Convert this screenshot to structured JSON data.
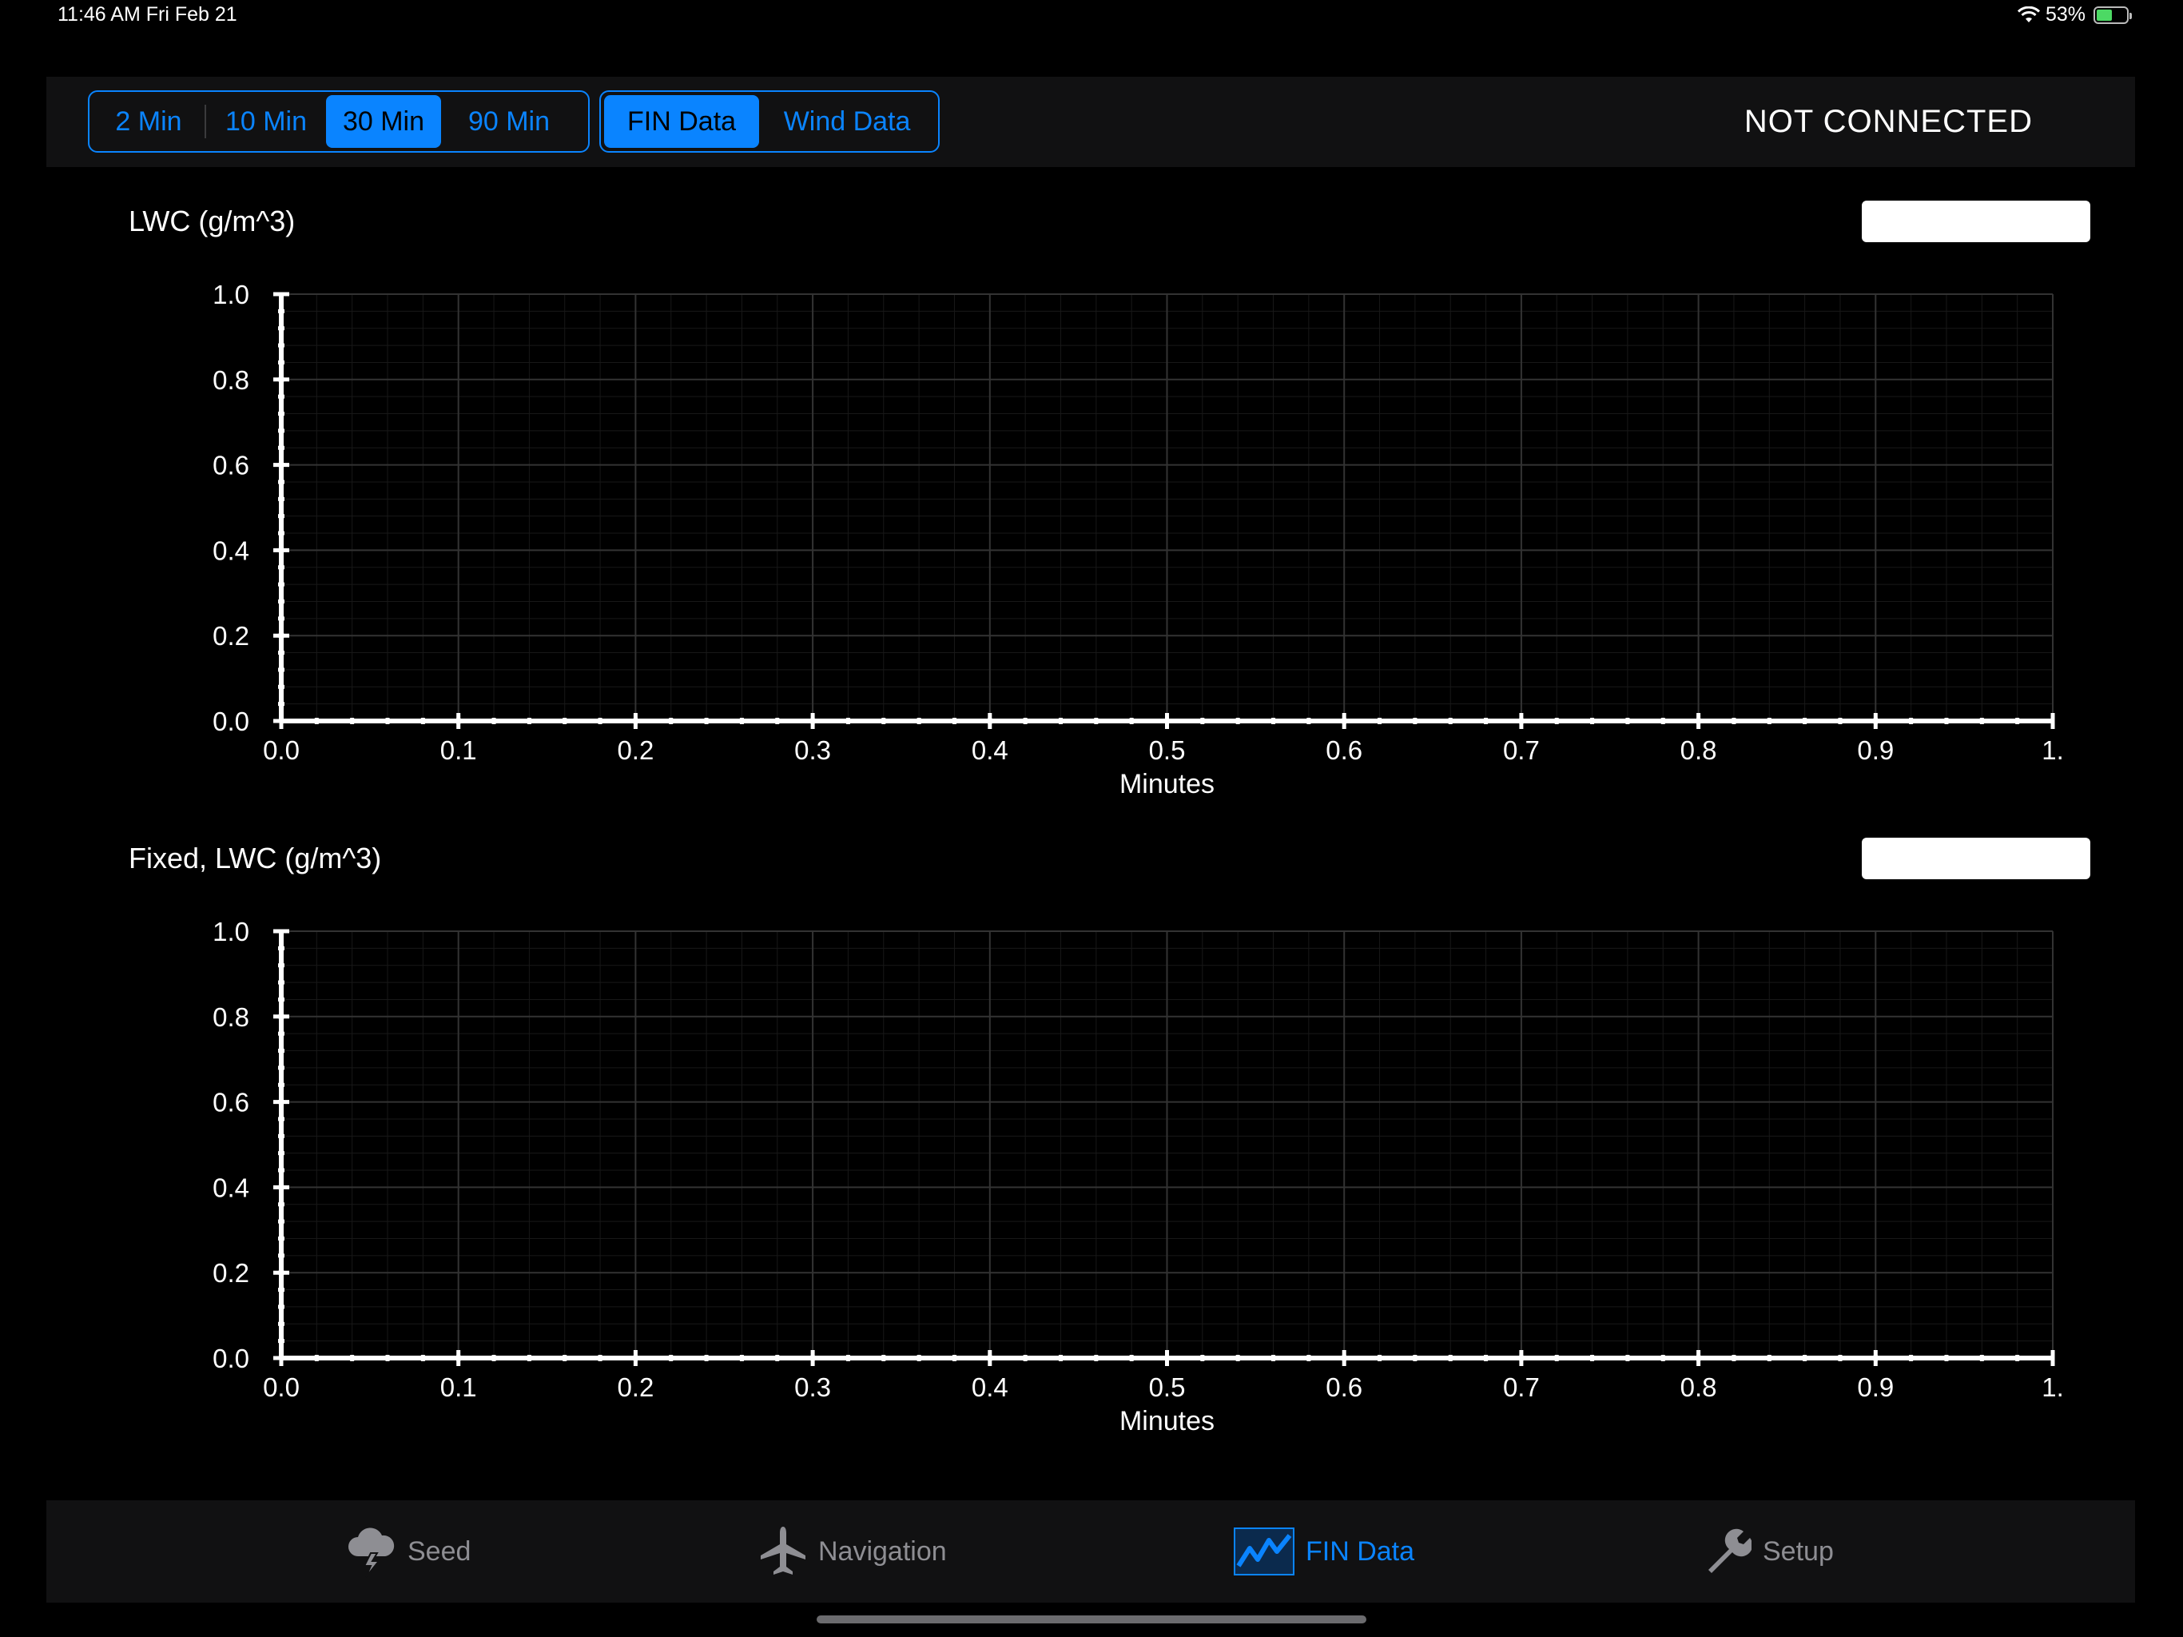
{
  "status_bar": {
    "time": "11:46 AM   Fri Feb 21",
    "battery": "53%",
    "battery_level": 0.53,
    "icons": [
      "wifi-icon",
      "battery-charging-icon"
    ]
  },
  "toolbar": {
    "time_ranges": [
      "2 Min",
      "10 Min",
      "30 Min",
      "90 Min"
    ],
    "selected_time_range": "30 Min",
    "data_views": [
      "FIN Data",
      "Wind Data"
    ],
    "selected_data_view": "FIN Data",
    "connection_status": "NOT CONNECTED"
  },
  "colors": {
    "accent": "#0a84ff",
    "background": "#000000",
    "bar_background": "#111112",
    "inactive_tab": "#8e8e93"
  },
  "panels": [
    {
      "title": "LWC (g/m^3)",
      "value": ""
    },
    {
      "title": "Fixed, LWC (g/m^3)",
      "value": ""
    }
  ],
  "chart_data": [
    {
      "type": "line",
      "title": "LWC (g/m^3)",
      "xlabel": "Minutes",
      "ylabel": "",
      "xlim": [
        0,
        1
      ],
      "ylim": [
        0,
        1
      ],
      "x_ticks": [
        "0.0",
        "0.1",
        "0.2",
        "0.3",
        "0.4",
        "0.5",
        "0.6",
        "0.7",
        "0.8",
        "0.9",
        "1."
      ],
      "y_ticks": [
        "0.0",
        "0.2",
        "0.4",
        "0.6",
        "0.8",
        "1.0"
      ],
      "grid": true,
      "series": []
    },
    {
      "type": "line",
      "title": "Fixed, LWC (g/m^3)",
      "xlabel": "Minutes",
      "ylabel": "",
      "xlim": [
        0,
        1
      ],
      "ylim": [
        0,
        1
      ],
      "x_ticks": [
        "0.0",
        "0.1",
        "0.2",
        "0.3",
        "0.4",
        "0.5",
        "0.6",
        "0.7",
        "0.8",
        "0.9",
        "1."
      ],
      "y_ticks": [
        "0.0",
        "0.2",
        "0.4",
        "0.6",
        "0.8",
        "1.0"
      ],
      "grid": true,
      "series": []
    }
  ],
  "tab_bar": {
    "items": [
      {
        "label": "Seed",
        "icon": "cloud-lightning-icon"
      },
      {
        "label": "Navigation",
        "icon": "airplane-icon"
      },
      {
        "label": "FIN Data",
        "icon": "line-chart-icon"
      },
      {
        "label": "Setup",
        "icon": "wrench-icon"
      }
    ],
    "active": "FIN Data"
  }
}
